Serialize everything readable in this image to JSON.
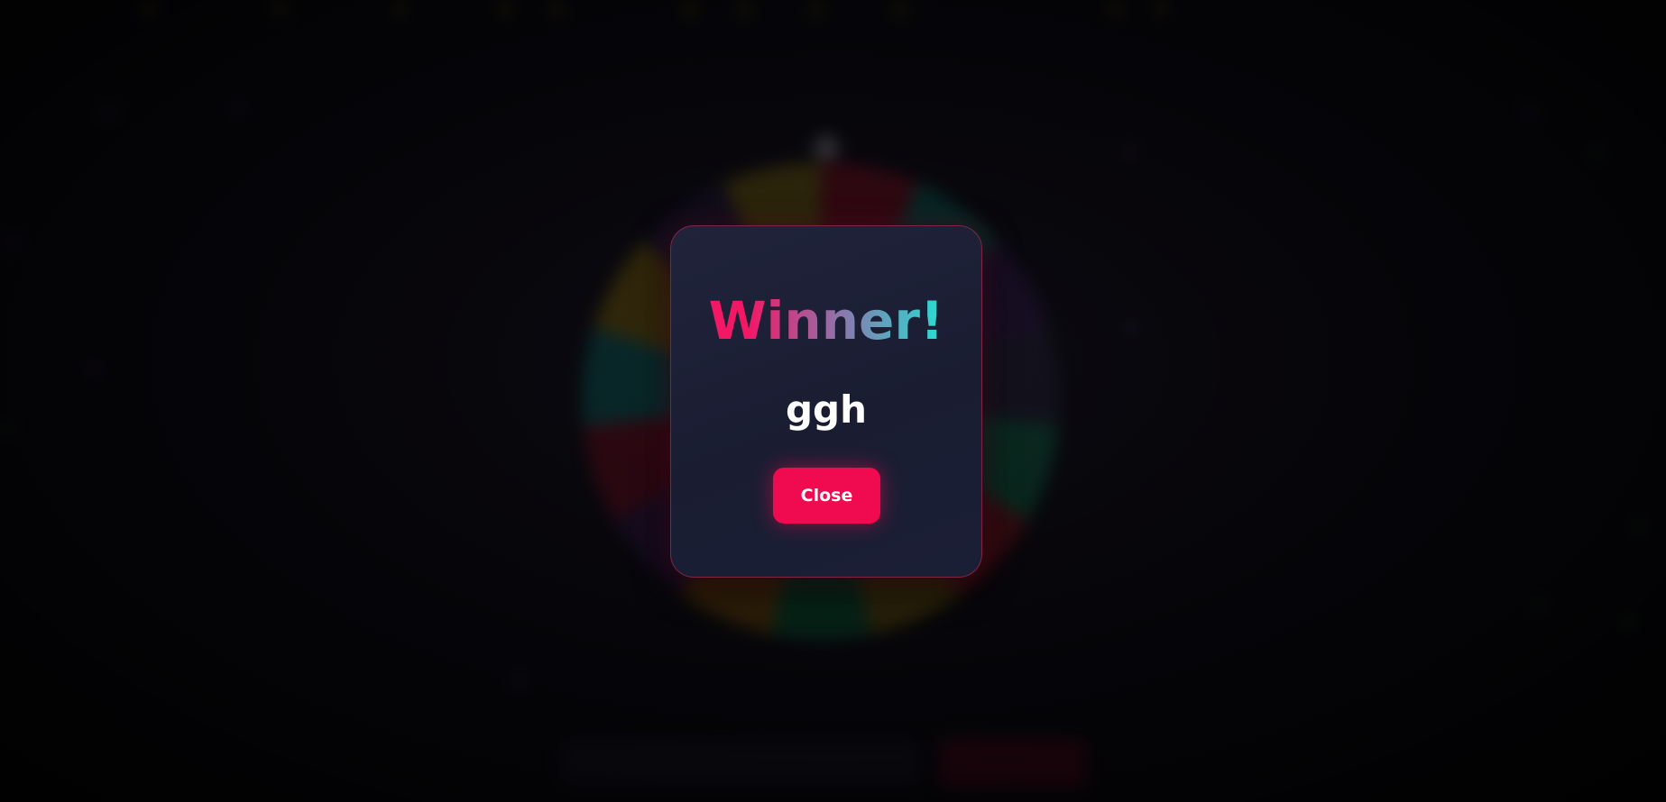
{
  "colors": {
    "accent": "#f00a4f",
    "modal_background": "#1d2035",
    "modal_border": "#d62850",
    "title_gradient": [
      "#f21866",
      "#8a78ae",
      "#2fd6cf"
    ],
    "text_primary": "#ffffff"
  },
  "modal": {
    "title": "Winner!",
    "winner_name": "ggh",
    "close_label": "Close"
  }
}
